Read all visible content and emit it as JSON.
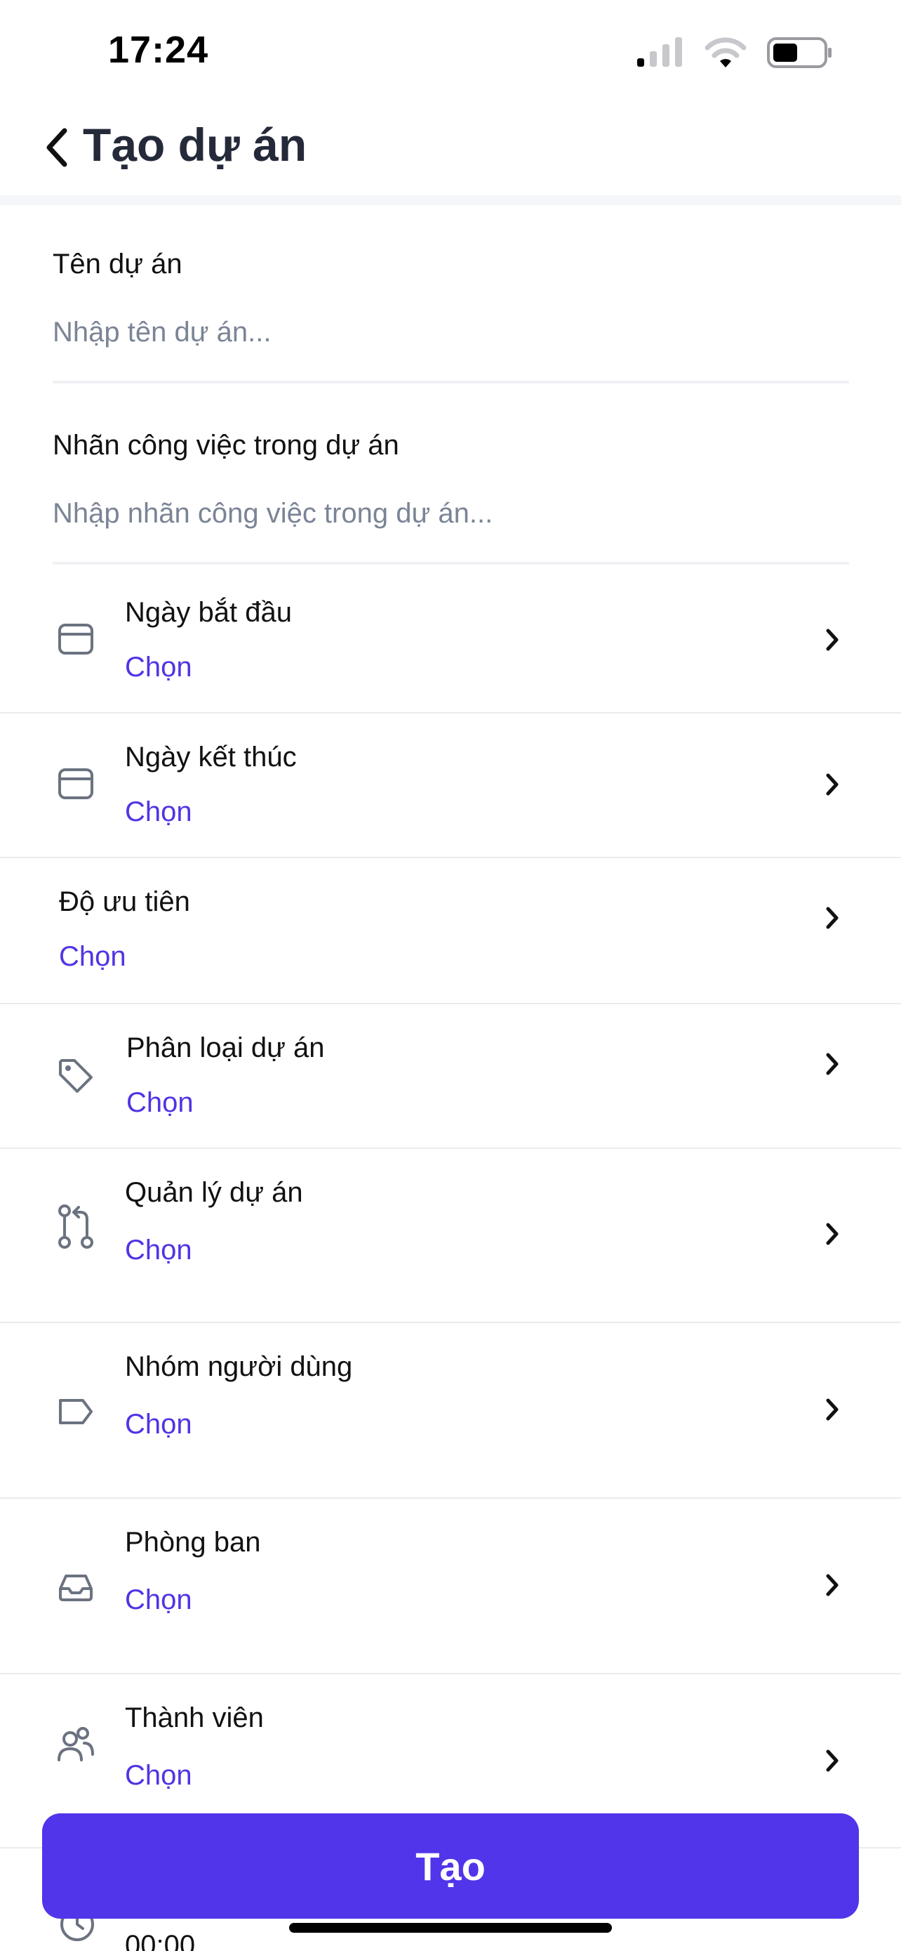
{
  "status_bar": {
    "time": "17:24",
    "icons": [
      "cellular-signal-icon",
      "wifi-icon",
      "battery-icon"
    ]
  },
  "header": {
    "back_icon": "chevron-left-icon",
    "title": "Tạo dự án"
  },
  "fields": {
    "project_name": {
      "label": "Tên dự án",
      "value": "",
      "placeholder": "Nhập tên dự án..."
    },
    "task_label": {
      "label": "Nhãn công việc trong dự án",
      "value": "",
      "placeholder": "Nhập nhãn công việc trong dự án..."
    }
  },
  "rows": [
    {
      "label": "Ngày bắt đầu",
      "value": "Chọn",
      "icon": "calendar-icon"
    },
    {
      "label": "Ngày kết thúc",
      "value": "Chọn",
      "icon": "calendar-icon"
    },
    {
      "label": "Độ ưu tiên",
      "value": "Chọn",
      "icon": ""
    },
    {
      "label": "Phân loại dự án",
      "value": "Chọn",
      "icon": "tag-icon"
    },
    {
      "label": "Quản lý dự án",
      "value": "Chọn",
      "icon": "git-pull-request-icon"
    },
    {
      "label": "Nhóm người dùng",
      "value": "Chọn",
      "icon": "label-tag-icon"
    },
    {
      "label": "Phòng ban",
      "value": "Chọn",
      "icon": "inbox-tray-icon"
    },
    {
      "label": "Thành viên",
      "value": "Chọn",
      "icon": "users-icon"
    }
  ],
  "peek_row": {
    "value": "00:00",
    "icon": "clock-icon"
  },
  "create_button": {
    "label": "Tạo"
  },
  "colors": {
    "accent": "#5035ea",
    "value_text": "#5134e4",
    "title_text": "#252a3a",
    "placeholder": "#7b8496",
    "icon_gray": "#6b7280"
  }
}
